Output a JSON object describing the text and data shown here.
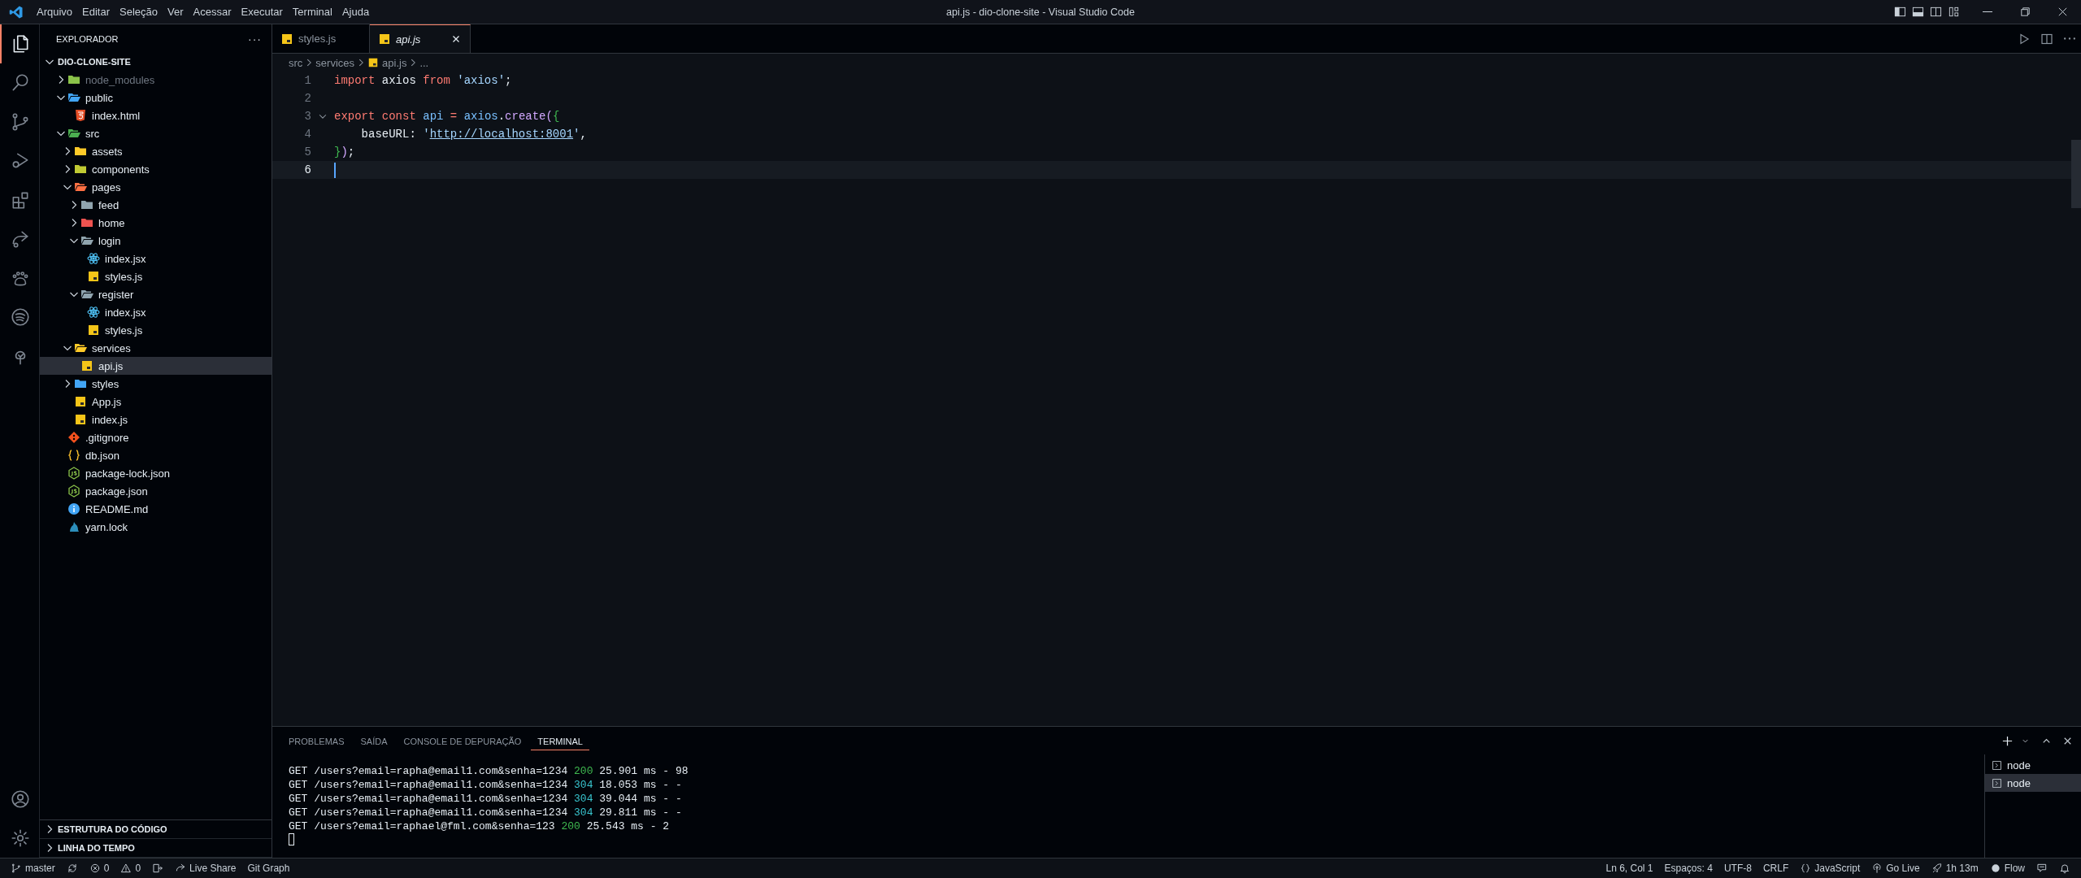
{
  "menu": [
    "Arquivo",
    "Editar",
    "Seleção",
    "Ver",
    "Acessar",
    "Executar",
    "Terminal",
    "Ajuda"
  ],
  "window": {
    "title": "api.js - dio-clone-site - Visual Studio Code"
  },
  "activity_bar": [
    {
      "kind": "files",
      "selected": true
    },
    {
      "kind": "search",
      "selected": false
    },
    {
      "kind": "source-control",
      "selected": false
    },
    {
      "kind": "run",
      "selected": false
    },
    {
      "kind": "extensions",
      "selected": false
    },
    {
      "kind": "share",
      "selected": false
    },
    {
      "kind": "paw",
      "selected": false
    },
    {
      "kind": "spotify",
      "selected": false
    },
    {
      "kind": "tree",
      "selected": false
    }
  ],
  "activity_bar_bottom": [
    {
      "kind": "account"
    },
    {
      "kind": "settings"
    }
  ],
  "explorer": {
    "title": "EXPLORADOR",
    "more": "···",
    "root": "DIO-CLONE-SITE",
    "tree": [
      {
        "name": "node_modules",
        "kind": "folder",
        "color": "#8bc34a",
        "expanded": false,
        "selected": false,
        "ignored": true
      },
      {
        "name": "public",
        "kind": "folder",
        "color": "#42a5f5",
        "expanded": true,
        "selected": false,
        "ignored": false,
        "children": [
          {
            "name": "index.html",
            "kind": "html",
            "selected": false
          }
        ]
      },
      {
        "name": "src",
        "kind": "folder",
        "color": "#4caf50",
        "expanded": true,
        "selected": false,
        "ignored": false,
        "children": [
          {
            "name": "assets",
            "kind": "folder",
            "color": "#ffca28",
            "expanded": false,
            "selected": false
          },
          {
            "name": "components",
            "kind": "folder",
            "color": "#c0ca33",
            "expanded": false,
            "selected": false
          },
          {
            "name": "pages",
            "kind": "folder",
            "color": "#ff7043",
            "expanded": true,
            "selected": false,
            "children": [
              {
                "name": "feed",
                "kind": "folder",
                "color": "#90a4ae",
                "expanded": false,
                "selected": false
              },
              {
                "name": "home",
                "kind": "folder",
                "color": "#ef5350",
                "expanded": false,
                "selected": false
              },
              {
                "name": "login",
                "kind": "folder",
                "color": "#90a4ae",
                "expanded": true,
                "selected": false,
                "children": [
                  {
                    "name": "index.jsx",
                    "kind": "jsx",
                    "selected": false
                  },
                  {
                    "name": "styles.js",
                    "kind": "js",
                    "selected": false
                  }
                ]
              },
              {
                "name": "register",
                "kind": "folder",
                "color": "#90a4ae",
                "expanded": true,
                "selected": false,
                "children": [
                  {
                    "name": "index.jsx",
                    "kind": "jsx",
                    "selected": false
                  },
                  {
                    "name": "styles.js",
                    "kind": "js",
                    "selected": false
                  }
                ]
              }
            ]
          },
          {
            "name": "services",
            "kind": "folder",
            "color": "#ffca28",
            "expanded": true,
            "selected": false,
            "children": [
              {
                "name": "api.js",
                "kind": "js",
                "selected": true
              }
            ]
          },
          {
            "name": "styles",
            "kind": "folder",
            "color": "#42a5f5",
            "expanded": false,
            "selected": false
          },
          {
            "name": "App.js",
            "kind": "js",
            "selected": false
          },
          {
            "name": "index.js",
            "kind": "js",
            "selected": false
          }
        ]
      },
      {
        "name": ".gitignore",
        "kind": "git",
        "selected": false,
        "ignored": false
      },
      {
        "name": "db.json",
        "kind": "json",
        "selected": false,
        "ignored": false
      },
      {
        "name": "package-lock.json",
        "kind": "node",
        "selected": false,
        "ignored": false
      },
      {
        "name": "package.json",
        "kind": "node",
        "selected": false,
        "ignored": false
      },
      {
        "name": "README.md",
        "kind": "info",
        "selected": false,
        "ignored": false
      },
      {
        "name": "yarn.lock",
        "kind": "yarn",
        "selected": false,
        "ignored": false
      }
    ],
    "sections": [
      {
        "title": "ESTRUTURA DO CÓDIGO",
        "expanded": false
      },
      {
        "title": "LINHA DO TEMPO",
        "expanded": false
      }
    ]
  },
  "tabs": [
    {
      "label": "styles.js",
      "kind": "js",
      "selected": false,
      "preview": false
    },
    {
      "label": "api.js",
      "kind": "js",
      "selected": true,
      "preview": true
    }
  ],
  "breadcrumb": [
    {
      "label": "src",
      "kind": "folder"
    },
    {
      "label": "services",
      "kind": "folder"
    },
    {
      "label": "api.js",
      "kind": "js"
    },
    {
      "label": "...",
      "kind": "more"
    }
  ],
  "code": [
    {
      "number": "1",
      "foldable": false,
      "current": false,
      "tokens": [
        {
          "text": "import ",
          "kind": "keyword"
        },
        {
          "text": "axios ",
          "kind": "plain"
        },
        {
          "text": "from ",
          "kind": "keyword"
        },
        {
          "text": "'axios'",
          "kind": "string"
        },
        {
          "text": ";",
          "kind": "plain"
        }
      ]
    },
    {
      "number": "2",
      "foldable": false,
      "current": false
    },
    {
      "number": "3",
      "foldable": true,
      "current": false,
      "tokens": [
        {
          "text": "export ",
          "kind": "keyword"
        },
        {
          "text": "const ",
          "kind": "keyword"
        },
        {
          "text": "api",
          "kind": "variable"
        },
        {
          "text": " = ",
          "kind": "keyword"
        },
        {
          "text": "axios",
          "kind": "variable"
        },
        {
          "text": ".",
          "kind": "plain"
        },
        {
          "text": "create",
          "kind": "function"
        },
        {
          "text": "(",
          "kind": "paren"
        },
        {
          "text": "{",
          "kind": "brace"
        }
      ]
    },
    {
      "number": "4",
      "foldable": false,
      "current": false,
      "tokens": [
        {
          "text": "    baseURL: ",
          "kind": "plain"
        },
        {
          "text": "'",
          "kind": "string"
        },
        {
          "text": "http://localhost:8001",
          "kind": "link"
        },
        {
          "text": "'",
          "kind": "string"
        },
        {
          "text": ",",
          "kind": "plain"
        }
      ]
    },
    {
      "number": "5",
      "foldable": false,
      "current": false,
      "tokens": [
        {
          "text": "}",
          "kind": "brace"
        },
        {
          "text": ")",
          "kind": "paren"
        },
        {
          "text": ";",
          "kind": "plain"
        }
      ]
    },
    {
      "number": "6",
      "foldable": false,
      "current": true
    }
  ],
  "panel": {
    "tabs": [
      {
        "label": "PROBLEMAS",
        "selected": false
      },
      {
        "label": "SAÍDA",
        "selected": false
      },
      {
        "label": "CONSOLE DE DEPURAÇÃO",
        "selected": false
      },
      {
        "label": "TERMINAL",
        "selected": true
      }
    ],
    "terminal": [
      {
        "request": "GET /users?email=rapha@email1.com&senha=1234",
        "status": "200",
        "kind": "ok",
        "rest": "25.901 ms - 98"
      },
      {
        "request": "GET /users?email=rapha@email1.com&senha=1234",
        "status": "304",
        "kind": "cached",
        "rest": "18.053 ms - -"
      },
      {
        "request": "GET /users?email=rapha@email1.com&senha=1234",
        "status": "304",
        "kind": "cached",
        "rest": "39.044 ms - -"
      },
      {
        "request": "GET /users?email=rapha@email1.com&senha=1234",
        "status": "304",
        "kind": "cached",
        "rest": "29.811 ms - -"
      },
      {
        "request": "GET /users?email=raphael@fml.com&senha=123",
        "status": "200",
        "kind": "ok",
        "rest": "25.543 ms - 2"
      }
    ],
    "sessions": [
      {
        "label": "node",
        "selected": false
      },
      {
        "label": "node",
        "selected": true
      }
    ]
  },
  "status_bar": {
    "left": [
      {
        "kind": "branch",
        "text": "master"
      },
      {
        "kind": "sync"
      },
      {
        "kind": "error",
        "text": "0"
      },
      {
        "kind": "warning",
        "text": "0"
      },
      {
        "kind": "port"
      },
      {
        "kind": "liveshare",
        "text": "Live Share"
      },
      {
        "kind": "none",
        "text": "Git Graph"
      }
    ],
    "right": [
      {
        "kind": "none",
        "text": "Ln 6, Col 1"
      },
      {
        "kind": "none",
        "text": "Espaços: 4"
      },
      {
        "kind": "none",
        "text": "UTF-8"
      },
      {
        "kind": "none",
        "text": "CRLF"
      },
      {
        "kind": "braces",
        "text": "JavaScript"
      },
      {
        "kind": "broadcast",
        "text": "Go Live"
      },
      {
        "kind": "rocket",
        "text": "1h 13m"
      },
      {
        "kind": "dot",
        "text": "Flow"
      },
      {
        "kind": "feedback"
      },
      {
        "kind": "bell"
      }
    ]
  }
}
